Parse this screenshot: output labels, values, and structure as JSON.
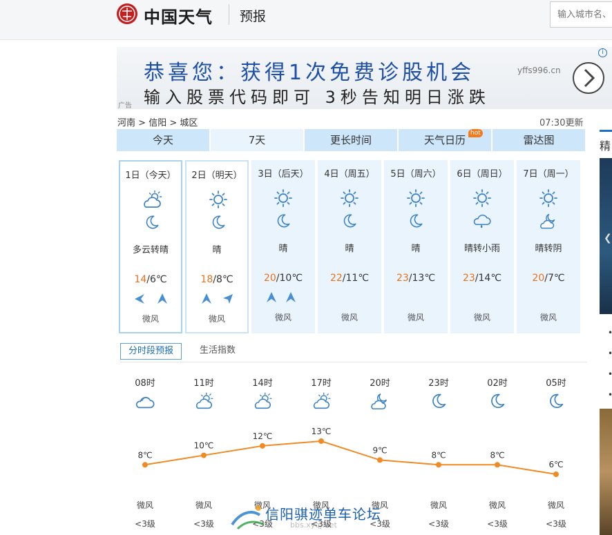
{
  "header": {
    "brand": "中国天气",
    "section": "预报",
    "search_placeholder": "输入城市名、"
  },
  "ad": {
    "line1": "恭喜您：获得1次免费诊股机会",
    "url": "yffs996.cn",
    "line2": "输入股票代码即可 3秒告知明日涨跌",
    "tag": "广告",
    "info": "i"
  },
  "breadcrumb": {
    "province": "河南",
    "city": "信阳",
    "district": "城区",
    "sep": ">"
  },
  "updated": "07:30更新",
  "tabs": [
    {
      "label": "今天"
    },
    {
      "label": "7天"
    },
    {
      "label": "更长时间"
    },
    {
      "label": "天气日历",
      "badge": "hot"
    },
    {
      "label": "雷达图"
    }
  ],
  "days": [
    {
      "date": "1日（今天）",
      "icon_day": "partly-cloudy-sun-icon",
      "icon_night": "moon-icon",
      "weather": "多云转晴",
      "high": "14",
      "low": "6℃",
      "wind": "微风"
    },
    {
      "date": "2日（明天）",
      "icon_day": "sun-icon",
      "icon_night": "moon-icon",
      "weather": "晴",
      "high": "18",
      "low": "8℃",
      "wind": "微风"
    },
    {
      "date": "3日（后天）",
      "icon_day": "sun-icon",
      "icon_night": "moon-icon",
      "weather": "晴",
      "high": "20",
      "low": "10℃",
      "wind": "微风"
    },
    {
      "date": "4日（周五）",
      "icon_day": "sun-icon",
      "icon_night": "moon-icon",
      "weather": "晴",
      "high": "22",
      "low": "11℃",
      "wind": "微风"
    },
    {
      "date": "5日（周六）",
      "icon_day": "sun-icon",
      "icon_night": "moon-icon",
      "weather": "晴",
      "high": "23",
      "low": "13℃",
      "wind": "微风"
    },
    {
      "date": "6日（周日）",
      "icon_day": "sun-icon",
      "icon_night": "rain-cloud-icon",
      "weather": "晴转小雨",
      "high": "23",
      "low": "14℃",
      "wind": "微风"
    },
    {
      "date": "7日（周一）",
      "icon_day": "sun-icon",
      "icon_night": "cloudy-moon-icon",
      "weather": "晴转阴",
      "high": "20",
      "low": "7℃",
      "wind": "微风"
    }
  ],
  "temp_sep": "/",
  "subtabs": {
    "active": "分时段预报",
    "other": "生活指数"
  },
  "hourly": [
    {
      "time": "08时",
      "icon": "cloudy-icon",
      "temp": 8,
      "temp_label": "8℃",
      "wind": "微风",
      "level": "<3级"
    },
    {
      "time": "11时",
      "icon": "partly-cloudy-sun-icon",
      "temp": 10,
      "temp_label": "10℃",
      "wind": "微风",
      "level": "<3级"
    },
    {
      "time": "14时",
      "icon": "partly-cloudy-sun-icon",
      "temp": 12,
      "temp_label": "12℃",
      "wind": "微风",
      "level": "<3级"
    },
    {
      "time": "17时",
      "icon": "partly-cloudy-sun-icon",
      "temp": 13,
      "temp_label": "13℃",
      "wind": "微风",
      "level": "<3级"
    },
    {
      "time": "20时",
      "icon": "cloudy-moon-icon",
      "temp": 9,
      "temp_label": "9℃",
      "wind": "微风",
      "level": "<3级"
    },
    {
      "time": "23时",
      "icon": "moon-icon",
      "temp": 8,
      "temp_label": "8℃",
      "wind": "微风",
      "level": "<3级"
    },
    {
      "time": "02时",
      "icon": "moon-icon",
      "temp": 8,
      "temp_label": "8℃",
      "wind": "微风",
      "level": "<3级"
    },
    {
      "time": "05时",
      "icon": "moon-icon",
      "temp": 6,
      "temp_label": "6℃",
      "wind": "微风",
      "level": "<3级"
    }
  ],
  "side": {
    "title": "精",
    "bullets": [
      "•",
      "•",
      "•",
      "•"
    ]
  },
  "watermark": {
    "text": "信阳骐迹单车论坛",
    "sub": "bbs.xyqj.net"
  },
  "colors": {
    "accent": "#1d6fc8",
    "high_temp": "#e8711c",
    "tab_bg": "#cde6fa",
    "line": "#f08a24"
  }
}
